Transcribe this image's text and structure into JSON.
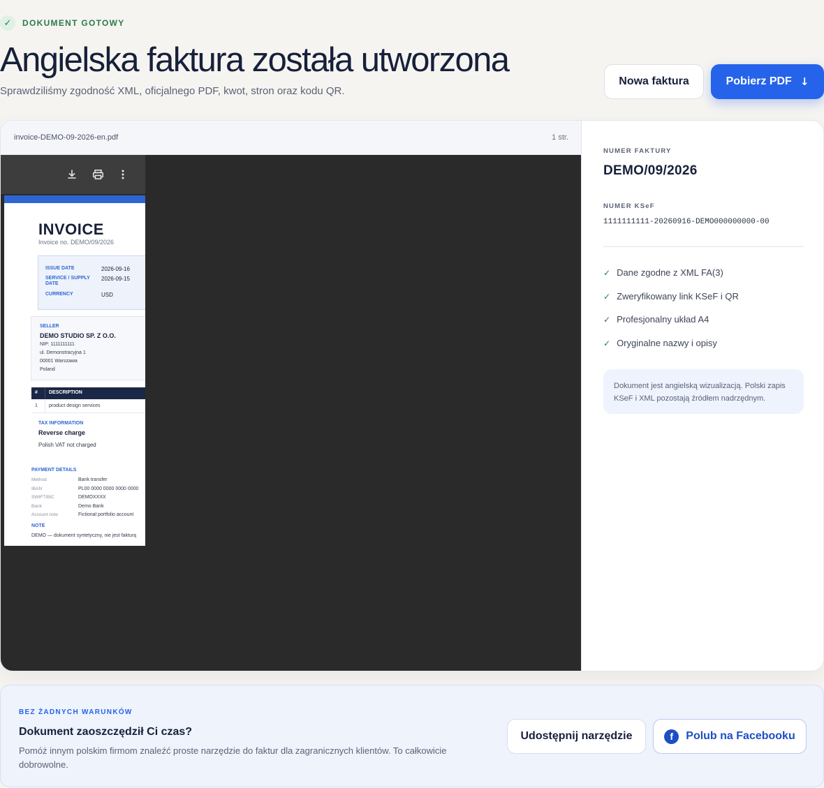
{
  "status": {
    "icon": "check-icon",
    "text": "DOKUMENT GOTOWY"
  },
  "header": {
    "title": "Angielska faktura została utworzona",
    "subtitle": "Sprawdziliśmy zgodność XML, oficjalnego PDF, kwot, stron oraz kodu QR.",
    "new_invoice_label": "Nowa faktura",
    "download_label": "Pobierz PDF",
    "download_icon": "arrow-down-icon"
  },
  "preview": {
    "filename": "invoice-DEMO-09-2026-en.pdf",
    "pages": "1 str.",
    "toolbar_icons": [
      "download-icon",
      "print-icon",
      "more-vertical-icon"
    ],
    "invoice": {
      "title": "INVOICE",
      "number_line": "Invoice no. DEMO/09/2026",
      "meta": [
        {
          "label": "ISSUE DATE",
          "value": "2026-09-16"
        },
        {
          "label": "SERVICE / SUPPLY DATE",
          "value": "2026-09-15"
        },
        {
          "label": "CURRENCY",
          "value": "USD"
        }
      ],
      "seller": {
        "label": "SELLER",
        "name": "DEMO STUDIO SP. Z O.O.",
        "lines": [
          "NIP: 1111111111",
          "ul. Demonstracyjna 1",
          "00001 Warszawa",
          "Poland"
        ]
      },
      "table": {
        "headers": [
          "#",
          "DESCRIPTION"
        ],
        "rows": [
          {
            "num": "1",
            "desc": "product design services"
          }
        ]
      },
      "tax": {
        "label": "TAX INFORMATION",
        "title": "Reverse charge",
        "note": "Polish VAT not charged"
      },
      "payment": {
        "label": "PAYMENT DETAILS",
        "rows": [
          {
            "key": "Method",
            "value": "Bank transfer"
          },
          {
            "key": "IBAN",
            "value": "PL00 0000 0000 0000 0000"
          },
          {
            "key": "SWIFT/BIC",
            "value": "DEMOXXXX"
          },
          {
            "key": "Bank",
            "value": "Demo Bank"
          },
          {
            "key": "Account note",
            "value": "Fictional portfolio account"
          }
        ]
      },
      "note": {
        "label": "NOTE",
        "text": "DEMO — dokument syntetyczny, nie jest fakturą"
      }
    }
  },
  "side": {
    "invoice_number_label": "NUMER FAKTURY",
    "invoice_number": "DEMO/09/2026",
    "ksef_label": "NUMER KSeF",
    "ksef_number": "1111111111-20260916-DEMO000000000-00",
    "checks": [
      "Dane zgodne z XML FA(3)",
      "Zweryfikowany link KSeF i QR",
      "Profesjonalny układ A4",
      "Oryginalne nazwy i opisy"
    ],
    "note": "Dokument jest angielską wizualizacją. Polski zapis KSeF i XML pozostają źródłem nadrzędnym."
  },
  "footer": {
    "kicker": "BEZ ŻADNYCH WARUNKÓW",
    "title": "Dokument zaoszczędził Ci czas?",
    "description": "Pomóż innym polskim firmom znaleźć proste narzędzie do faktur dla zagranicznych klientów. To całkowicie dobrowolne.",
    "share_label": "Udostępnij narzędzie",
    "facebook_label": "Polub na Facebooku",
    "facebook_icon": "facebook-icon"
  }
}
